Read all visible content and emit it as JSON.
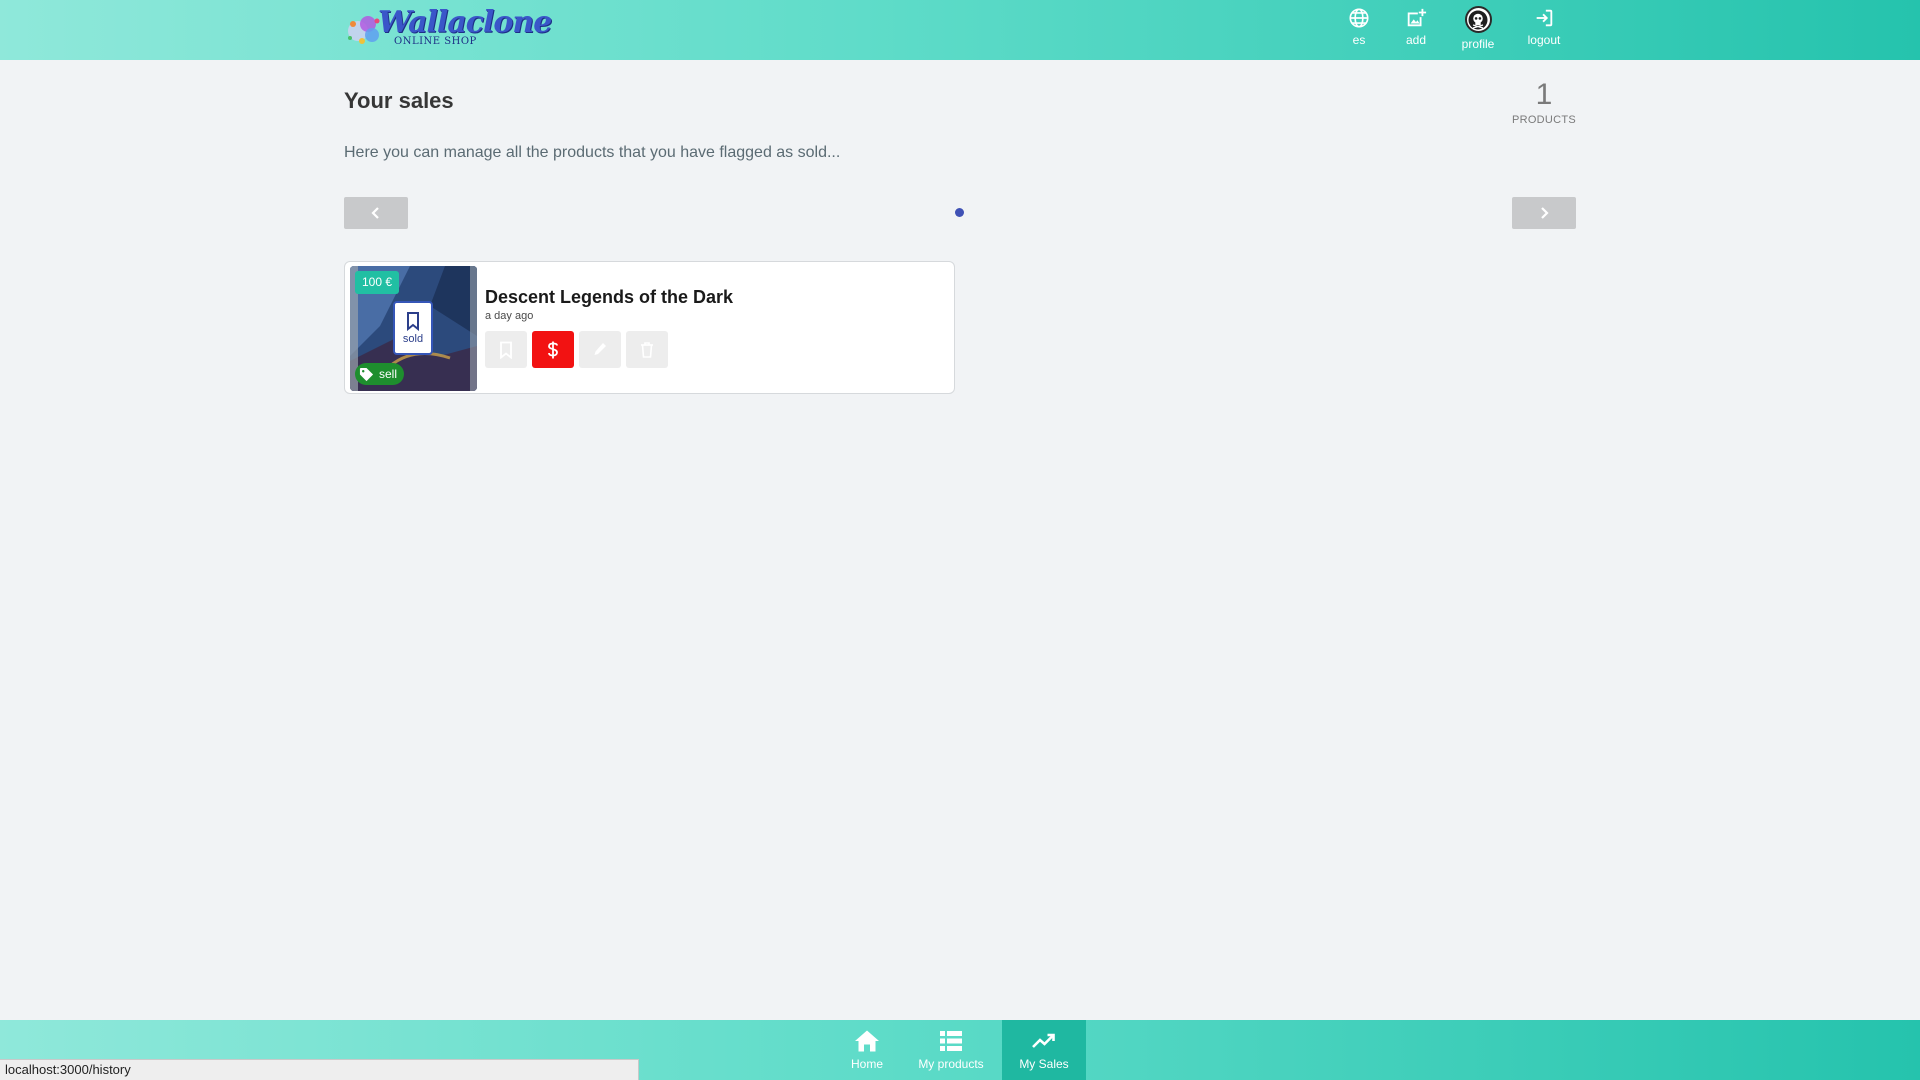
{
  "header": {
    "logo_main": "Wallaclone",
    "logo_sub": "ONLINE SHOP",
    "nav": [
      {
        "label": "es",
        "icon": "globe-icon"
      },
      {
        "label": "add",
        "icon": "add-image-icon"
      },
      {
        "label": "profile",
        "icon": "avatar"
      },
      {
        "label": "logout",
        "icon": "logout-icon"
      }
    ]
  },
  "main": {
    "title": "Your sales",
    "count": {
      "value": "1",
      "label": "PRODUCTS"
    },
    "subtitle": "Here you can manage all the products that you have flagged as sold...",
    "pagination": {
      "current_page": 1,
      "total_pages": 1
    }
  },
  "products": [
    {
      "title": "Descent Legends of the Dark",
      "time": "a day ago",
      "price": "100 €",
      "status_label": "sold",
      "type_label": "sell",
      "actions": [
        "bookmark-icon",
        "dollar-icon",
        "pencil-icon",
        "trash-icon"
      ]
    }
  ],
  "bottom_nav": [
    {
      "label": "Home",
      "icon": "home-icon",
      "active": false
    },
    {
      "label": "My products",
      "icon": "list-icon",
      "active": false
    },
    {
      "label": "My Sales",
      "icon": "trend-icon",
      "active": true
    }
  ],
  "status_bar": {
    "url": "localhost:3000/history"
  },
  "colors": {
    "accent": "#25c3ad",
    "sold_button": "#f21212",
    "price_tag": "#21bfa3",
    "sell_tag": "#1e8e2e",
    "pager_dot": "#3f51b5"
  }
}
